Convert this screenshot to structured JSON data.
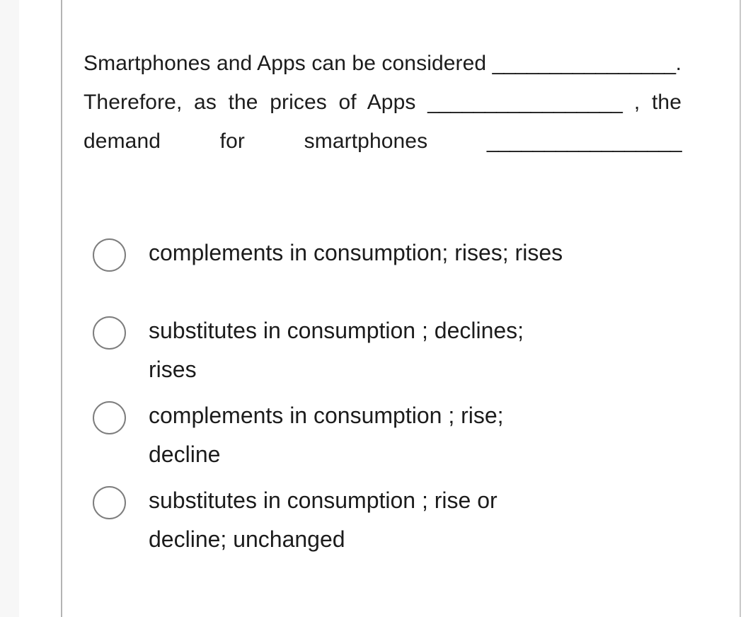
{
  "question": {
    "segment_1": "Smartphones and Apps can be considered ",
    "blank_1": "________________",
    "segment_2": ". Therefore, as the prices of Apps ",
    "blank_2": "_________________",
    "segment_3": " , the demand for smartphones ",
    "blank_3": "_________________",
    "full_text": "Smartphones and Apps can be considered ________________. Therefore, as the prices of Apps _________________ , the demand for smartphones _________________"
  },
  "options": [
    {
      "id": "option-a",
      "label": "complements in consumption; rises; rises",
      "selected": false
    },
    {
      "id": "option-b",
      "label": "substitutes in consumption ; declines; rises",
      "selected": false
    },
    {
      "id": "option-c",
      "label": "complements in consumption ; rise; decline",
      "selected": false
    },
    {
      "id": "option-d",
      "label": "substitutes in consumption ; rise or decline; unchanged",
      "selected": false
    }
  ],
  "colors": {
    "text": "#1c1c1c",
    "radio_border": "#7d7d7d",
    "card_border": "#b4b4b4",
    "gutter": "#f7f7f7",
    "background": "#ffffff"
  }
}
